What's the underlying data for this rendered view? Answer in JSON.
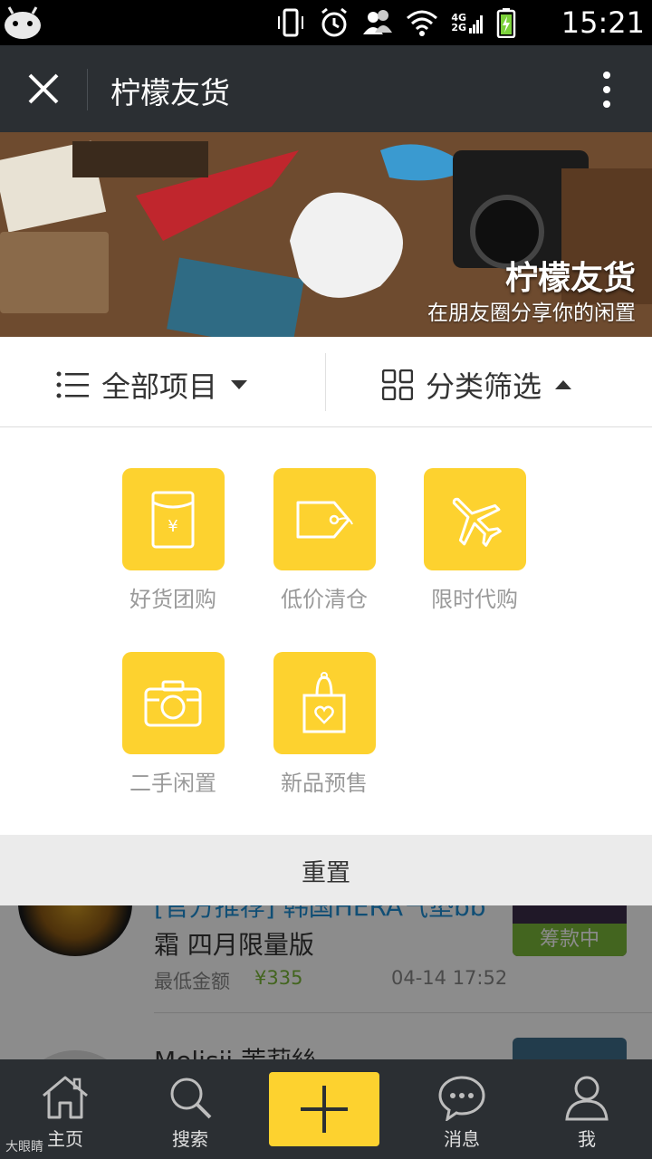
{
  "status_bar": {
    "network_top": "4G",
    "network_bottom": "2G",
    "time": "15:21"
  },
  "header": {
    "title": "柠檬友货"
  },
  "banner": {
    "title": "柠檬友货",
    "subtitle": "在朋友圈分享你的闲置"
  },
  "filters": {
    "all_label": "全部项目",
    "category_label": "分类筛选"
  },
  "categories": [
    {
      "label": "好货团购",
      "icon": "red-envelope-icon"
    },
    {
      "label": "低价清仓",
      "icon": "price-tag-icon"
    },
    {
      "label": "限时代购",
      "icon": "airplane-icon"
    },
    {
      "label": "二手闲置",
      "icon": "camera-icon"
    },
    {
      "label": "新品预售",
      "icon": "shopping-bag-heart-icon"
    }
  ],
  "reset_label": "重置",
  "list": {
    "item1_title_line1": "[官方推荐] 韩国HERA气垫bb",
    "item1_title_line2": "霜 四月限量版",
    "item1_price_label": "最低金额",
    "item1_price": "¥335",
    "item1_date": "04-14 17:52",
    "item1_badge": "筹款中",
    "item2_title": "Melisii 茉莉絲"
  },
  "tabs": [
    {
      "label": "主页",
      "icon": "home-icon"
    },
    {
      "label": "搜索",
      "icon": "search-icon"
    },
    {
      "label": "",
      "icon": "plus-icon"
    },
    {
      "label": "消息",
      "icon": "chat-icon"
    },
    {
      "label": "我",
      "icon": "user-icon"
    }
  ],
  "watermark": "大眼睛",
  "colors": {
    "accent": "#fdd22f",
    "dark_bar": "#2b2f33",
    "price_green": "#7bb83a",
    "link_blue": "#1e8fd6"
  }
}
